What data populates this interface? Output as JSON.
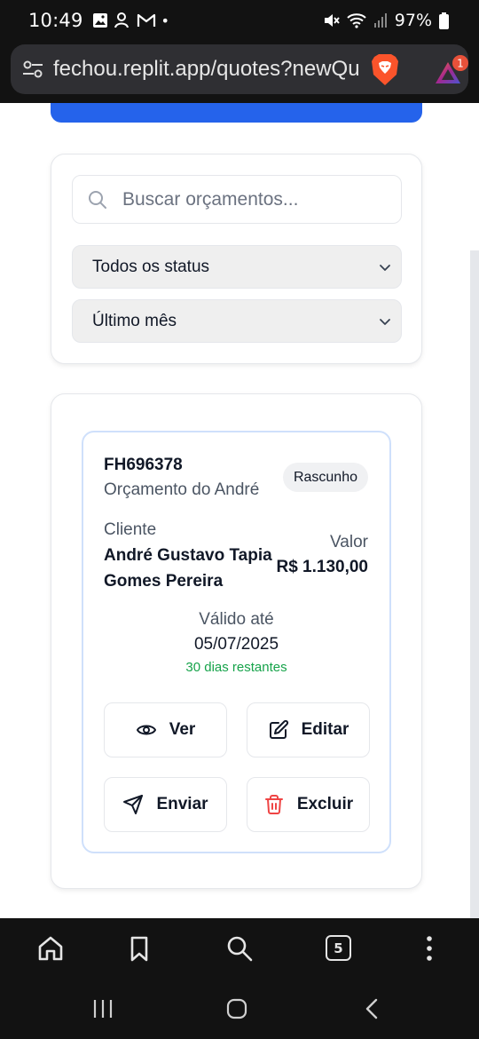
{
  "status_bar": {
    "time": "10:49",
    "dot": "•",
    "battery": "97%",
    "icons": [
      "gallery-icon",
      "accessibility-icon",
      "gmail-icon",
      "mute-icon",
      "wifi-icon",
      "signal-icon",
      "battery-icon"
    ]
  },
  "browser": {
    "url": "fechou.replit.app/quotes?newQuote",
    "rewards_badge": "1",
    "icons": [
      "site-settings-icon",
      "brave-shields-icon",
      "brave-rewards-icon"
    ]
  },
  "filters": {
    "search_placeholder": "Buscar orçamentos...",
    "status_select": "Todos os status",
    "period_select": "Último mês"
  },
  "quote": {
    "number": "FH696378",
    "title": "Orçamento do André",
    "status_badge": "Rascunho",
    "client_label": "Cliente",
    "client_name": "André Gustavo Tapia Gomes Pereira",
    "value_label": "Valor",
    "value": "R$ 1.130,00",
    "valid_label": "Válido até",
    "valid_date": "05/07/2025",
    "remaining": "30 dias restantes",
    "actions": {
      "view": "Ver",
      "edit": "Editar",
      "send": "Enviar",
      "delete": "Excluir"
    }
  },
  "toolbar": {
    "tabs_count": "5"
  },
  "colors": {
    "primary": "#2563eb",
    "success": "#16a34a",
    "danger": "#ef4444",
    "card_border_accent": "#cfe0fb"
  }
}
